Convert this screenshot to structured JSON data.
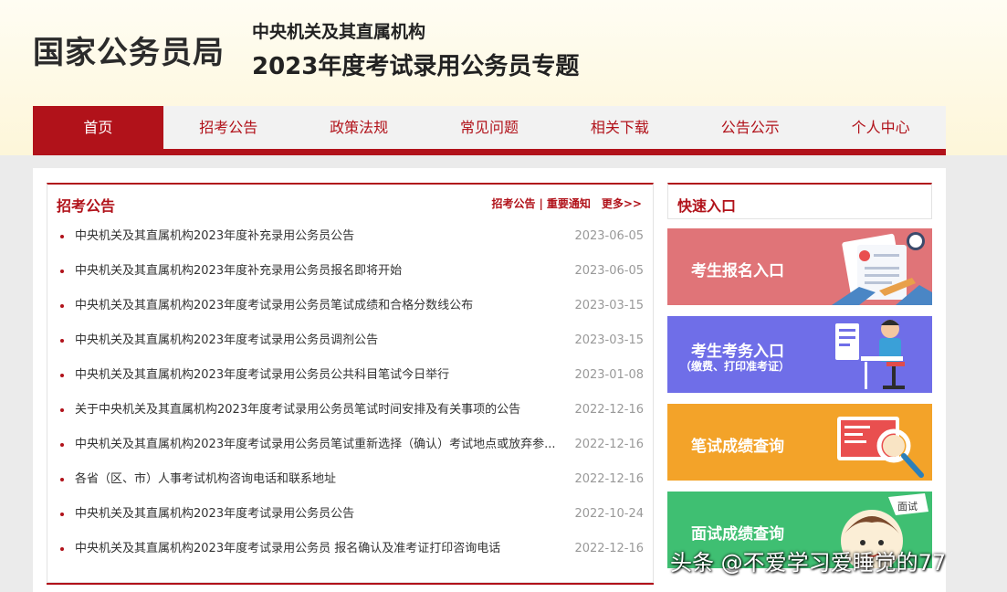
{
  "header": {
    "logo": "国家公务员局",
    "subtitle1": "中央机关及其直属机构",
    "subtitle2": "2023年度考试录用公务员专题"
  },
  "nav": [
    "首页",
    "招考公告",
    "政策法规",
    "常见问题",
    "相关下载",
    "公告公示",
    "个人中心"
  ],
  "news": {
    "title": "招考公告",
    "link1": "招考公告",
    "separator": "|",
    "link2": "重要通知",
    "more": "更多>>",
    "items": [
      {
        "title": "中央机关及其直属机构2023年度补充录用公务员公告",
        "date": "2023-06-05"
      },
      {
        "title": "中央机关及其直属机构2023年度补充录用公务员报名即将开始",
        "date": "2023-06-05"
      },
      {
        "title": "中央机关及其直属机构2023年度考试录用公务员笔试成绩和合格分数线公布",
        "date": "2023-03-15"
      },
      {
        "title": "中央机关及其直属机构2023年度考试录用公务员调剂公告",
        "date": "2023-03-15"
      },
      {
        "title": "中央机关及其直属机构2023年度考试录用公务员公共科目笔试今日举行",
        "date": "2023-01-08"
      },
      {
        "title": "关于中央机关及其直属机构2023年度考试录用公务员笔试时间安排及有关事项的公告",
        "date": "2022-12-16"
      },
      {
        "title": "中央机关及其直属机构2023年度考试录用公务员笔试重新选择（确认）考试地点或放弃参...",
        "date": "2022-12-16"
      },
      {
        "title": "各省（区、市）人事考试机构咨询电话和联系地址",
        "date": "2022-12-16"
      },
      {
        "title": "中央机关及其直属机构2023年度考试录用公务员公告",
        "date": "2022-10-24"
      },
      {
        "title": "中央机关及其直属机构2023年度考试录用公务员 报名确认及准考证打印咨询电话",
        "date": "2022-12-16"
      }
    ]
  },
  "quick": {
    "title": "快速入口",
    "btn1": "考生报名入口",
    "btn2": "考生考务入口",
    "btn2_sub": "（缴费、打印准考证）",
    "btn3": "笔试成绩查询",
    "btn4": "面试成绩查询",
    "btn4_badge": "面试"
  },
  "watermark": "头条 @不爱学习爱睡觉的77",
  "colors": {
    "accent": "#b1121a",
    "q1": "#e07478",
    "q2": "#6f6ee8",
    "q3": "#f3a329",
    "q4": "#3fbf72"
  }
}
